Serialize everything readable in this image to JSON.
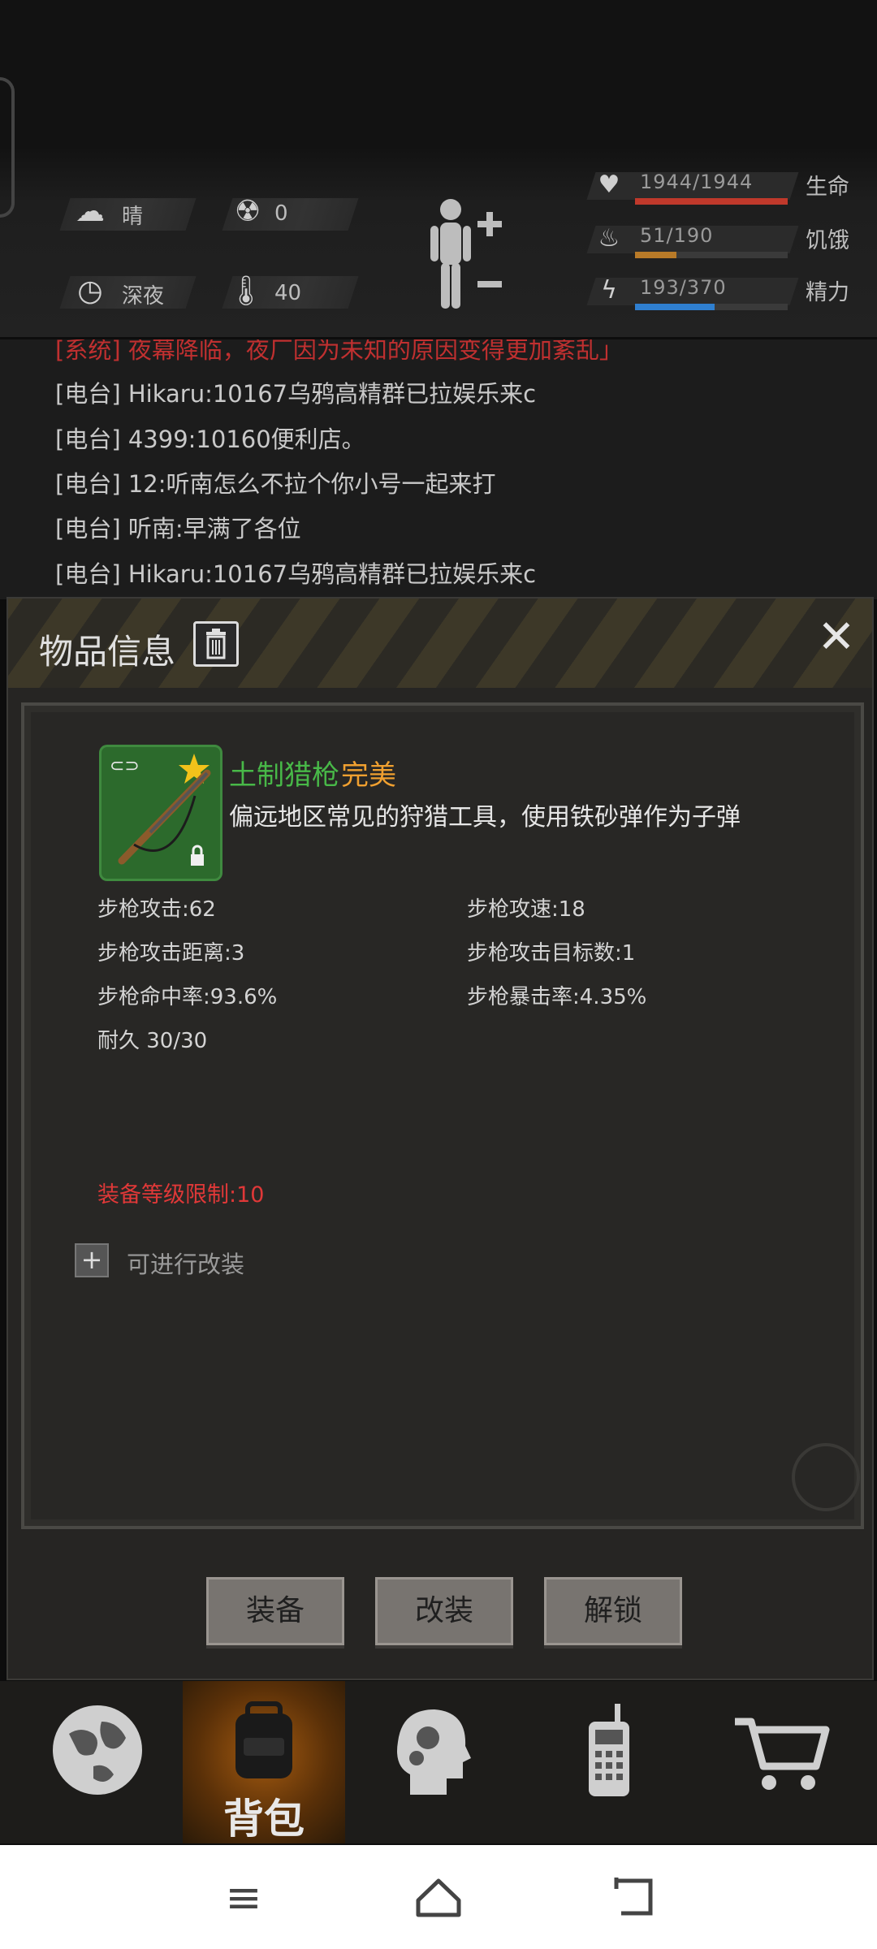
{
  "hud": {
    "weather": "晴",
    "radiation": "0",
    "time_of_day": "深夜",
    "temperature": "40",
    "health": {
      "value": "1944/1944",
      "label": "生命",
      "fraction": 1.0,
      "color": "#c0392b"
    },
    "hunger": {
      "value": "51/190",
      "label": "饥饿",
      "fraction": 0.27,
      "color": "#b87a28"
    },
    "energy": {
      "value": "193/370",
      "label": "精力",
      "fraction": 0.52,
      "color": "#2f7fd0"
    }
  },
  "chat": {
    "lines": [
      "[系统] 夜幕降临，夜厂因为未知的原因变得更加紊乱」",
      "[电台] Hikaru:10167乌鸦高精群已拉娱乐来c",
      "[电台] 4399:10160便利店。",
      "[电台] 12:听南怎么不拉个你小号一起来打",
      "[电台] 听南:早满了各位",
      "[电台] Hikaru:10167乌鸦高精群已拉娱乐来c"
    ]
  },
  "dialog": {
    "title": "物品信息",
    "item": {
      "name": "土制猎枪",
      "quality": "完美",
      "description": "偏远地区常见的狩猎工具，使用铁砂弹作为子弹"
    },
    "attributes": [
      "步枪攻击:62",
      "步枪攻速:18",
      "步枪攻击距离:3",
      "步枪攻击目标数:1",
      "步枪命中率:93.6%",
      "步枪暴击率:4.35%",
      "耐久 30/30"
    ],
    "level_requirement": "装备等级限制:10",
    "modifiable_text": "可进行改装",
    "buttons": {
      "equip": "装备",
      "modify": "改装",
      "unlock": "解锁"
    }
  },
  "tabs": {
    "bag_label": "背包",
    "icons": [
      "globe-icon",
      "backpack-icon",
      "head-gears-icon",
      "radio-icon",
      "cart-icon"
    ]
  },
  "colors": {
    "accent_green": "#48b848",
    "quality_orange": "#f0a030",
    "warning_red": "#e03838"
  }
}
